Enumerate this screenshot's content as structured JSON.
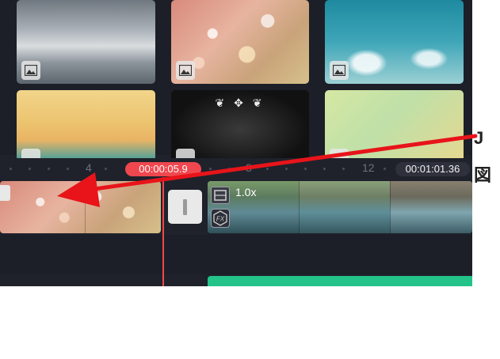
{
  "timeline": {
    "ruler_labels": [
      "4",
      "8",
      "12"
    ],
    "current_time": "00:00:05.9",
    "total_time": "00:01:01.36"
  },
  "media_items": [
    {
      "name": "mountain",
      "icon": "image-icon"
    },
    {
      "name": "bokeh-pink",
      "icon": "image-icon"
    },
    {
      "name": "sky-clouds",
      "icon": "image-icon"
    },
    {
      "name": "sunset-gradient",
      "icon": "image-icon"
    },
    {
      "name": "dark-ornament",
      "icon": "image-icon"
    },
    {
      "name": "green-gradient",
      "icon": "image-icon"
    }
  ],
  "clips": {
    "video_clip_speed": "1.0x",
    "fx_label": "FX",
    "text_track_label": ""
  },
  "right_text": {
    "line1": "J",
    "line2": "図"
  },
  "colors": {
    "accent_red": "#f0474f",
    "app_background": "#1f222b",
    "text_clip_green": "#23c38a",
    "annotation_arrow": "#e8141a"
  }
}
